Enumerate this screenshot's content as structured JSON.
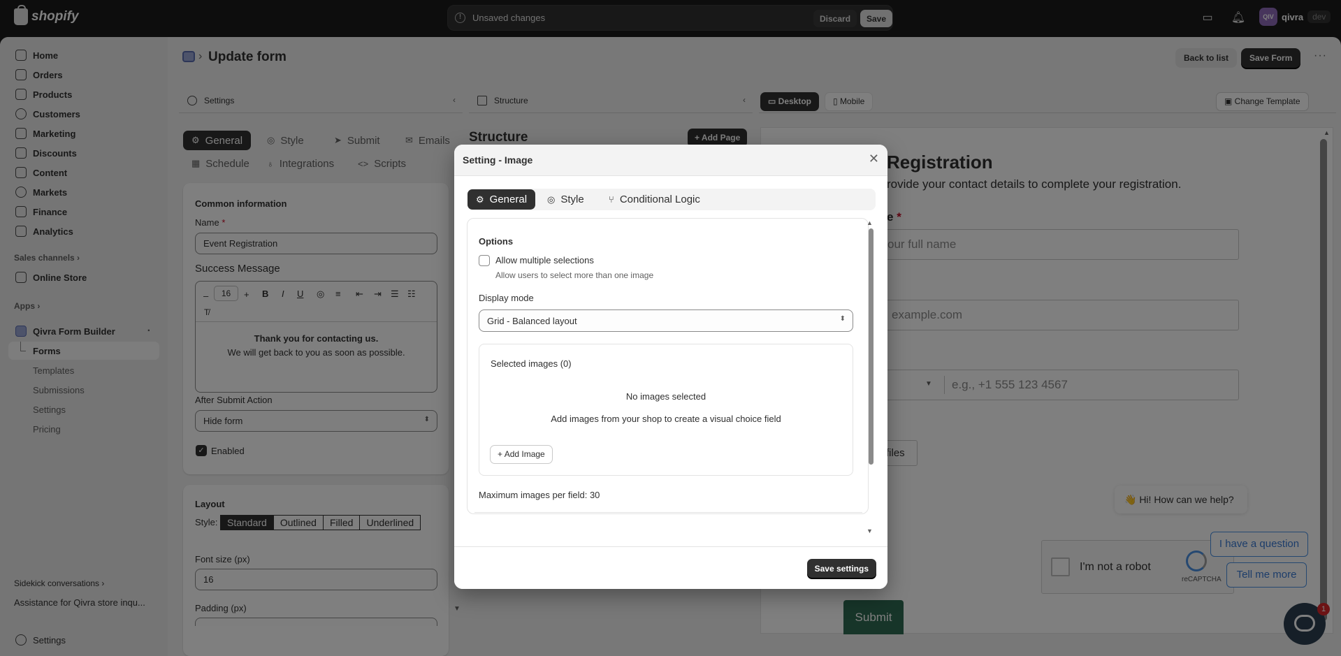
{
  "topbar": {
    "brand": "shopify",
    "unsaved_text": "Unsaved changes",
    "discard_label": "Discard",
    "save_label": "Save",
    "store_initials": "QIV",
    "store_name": "qivra",
    "store_badge": "dev"
  },
  "sidebar": {
    "items": [
      {
        "label": "Home",
        "icon": "home-icon"
      },
      {
        "label": "Orders",
        "icon": "orders-icon"
      },
      {
        "label": "Products",
        "icon": "products-icon"
      },
      {
        "label": "Customers",
        "icon": "customers-icon"
      },
      {
        "label": "Marketing",
        "icon": "marketing-icon"
      },
      {
        "label": "Discounts",
        "icon": "discounts-icon"
      },
      {
        "label": "Content",
        "icon": "content-icon"
      },
      {
        "label": "Markets",
        "icon": "markets-icon"
      },
      {
        "label": "Finance",
        "icon": "finance-icon"
      },
      {
        "label": "Analytics",
        "icon": "analytics-icon"
      }
    ],
    "sales_channels": "Sales channels",
    "online_store": "Online Store",
    "apps": "Apps",
    "app_name": "Qivra Form Builder",
    "app_sub": [
      "Forms",
      "Templates",
      "Submissions",
      "Settings",
      "Pricing"
    ],
    "sidekick": "Sidekick conversations",
    "assistance": "Assistance for Qivra store inqu...",
    "settings": "Settings"
  },
  "page": {
    "title": "Update form",
    "back_to_list": "Back to list",
    "save_form": "Save Form"
  },
  "columns": {
    "settings": "Settings",
    "structure": "Structure",
    "desktop": "Desktop",
    "mobile": "Mobile",
    "change_template": "Change Template"
  },
  "settings_tabs": {
    "row1": [
      "General",
      "Style",
      "Submit",
      "Emails"
    ],
    "row2": [
      "Schedule",
      "Integrations",
      "Scripts"
    ]
  },
  "common_info": {
    "heading": "Common information",
    "name_label": "Name",
    "name_value": "Event Registration",
    "success_label": "Success Message",
    "font_size": "16",
    "message_line1": "Thank you for contacting us.",
    "message_line2": "We will get back to you as soon as possible.",
    "after_submit_label": "After Submit Action",
    "after_submit_value": "Hide form",
    "enabled_label": "Enabled"
  },
  "layout": {
    "heading": "Layout",
    "style_label": "Style:",
    "styles": [
      "Standard",
      "Outlined",
      "Filled",
      "Underlined"
    ],
    "selected_style": "Standard",
    "font_size_label": "Font size (px)",
    "font_size_value": "16",
    "padding_label": "Padding (px)"
  },
  "structure": {
    "heading": "Structure",
    "add_page": "Add Page"
  },
  "preview": {
    "title": "Registration",
    "subtitle": "rovide your contact details to complete your registration.",
    "name_label_tail": "e",
    "name_placeholder": "our full name",
    "email_placeholder": "example.com",
    "phone_placeholder": "e.g., +1 555 123 4567",
    "files_label": "files",
    "chat_greeting": "👋 Hi! How can we help?",
    "chat_option1": "I have a question",
    "chat_option2": "Tell me more",
    "captcha_label": "I'm not a robot",
    "captcha_brand": "reCAPTCHA",
    "submit": "Submit",
    "chat_badge": "1"
  },
  "modal": {
    "title": "Setting - Image",
    "tabs": [
      "General",
      "Style",
      "Conditional Logic"
    ],
    "options_heading": "Options",
    "allow_multiple_label": "Allow multiple selections",
    "allow_multiple_help": "Allow users to select more than one image",
    "display_mode_label": "Display mode",
    "display_mode_value": "Grid - Balanced layout",
    "selected_images": "Selected images (0)",
    "no_images": "No images selected",
    "no_images_help": "Add images from your shop to create a visual choice field",
    "add_image": "Add Image",
    "max_images": "Maximum images per field: 30",
    "save_settings": "Save settings"
  }
}
